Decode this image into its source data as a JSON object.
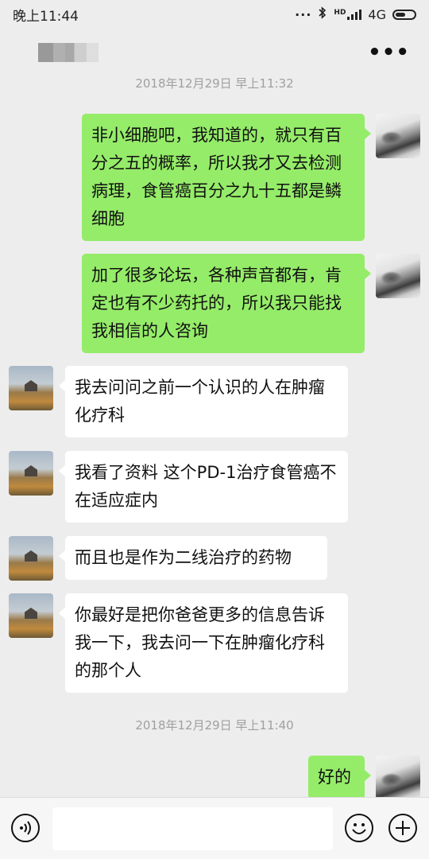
{
  "status_bar": {
    "time": "晚上11:44",
    "network": "4G",
    "hd_label": "HD"
  },
  "header": {
    "more_label": "•••"
  },
  "timestamps": [
    "2018年12月29日 早上11:32",
    "2018年12月29日 早上11:40"
  ],
  "messages": [
    {
      "direction": "out",
      "text": "非小细胞吧，我知道的，就只有百分之五的概率，所以我才又去检测病理，食管癌百分之九十五都是鳞细胞"
    },
    {
      "direction": "out",
      "text": "加了很多论坛，各种声音都有，肯定也有不少药托的，所以我只能找我相信的人咨询"
    },
    {
      "direction": "in",
      "text": "我去问问之前一个认识的人在肿瘤化疗科"
    },
    {
      "direction": "in",
      "text": "我看了资料  这个PD-1治疗食管癌不在适应症内"
    },
    {
      "direction": "in",
      "text": "而且也是作为二线治疗的药物"
    },
    {
      "direction": "in",
      "text": "你最好是把你爸爸更多的信息告诉我一下，我去问一下在肿瘤化疗科的那个人"
    },
    {
      "direction": "out",
      "text": "好的"
    }
  ],
  "input_bar": {
    "message_value": ""
  },
  "colors": {
    "background": "#ededed",
    "outgoing_bubble": "#95ec69",
    "incoming_bubble": "#ffffff"
  }
}
